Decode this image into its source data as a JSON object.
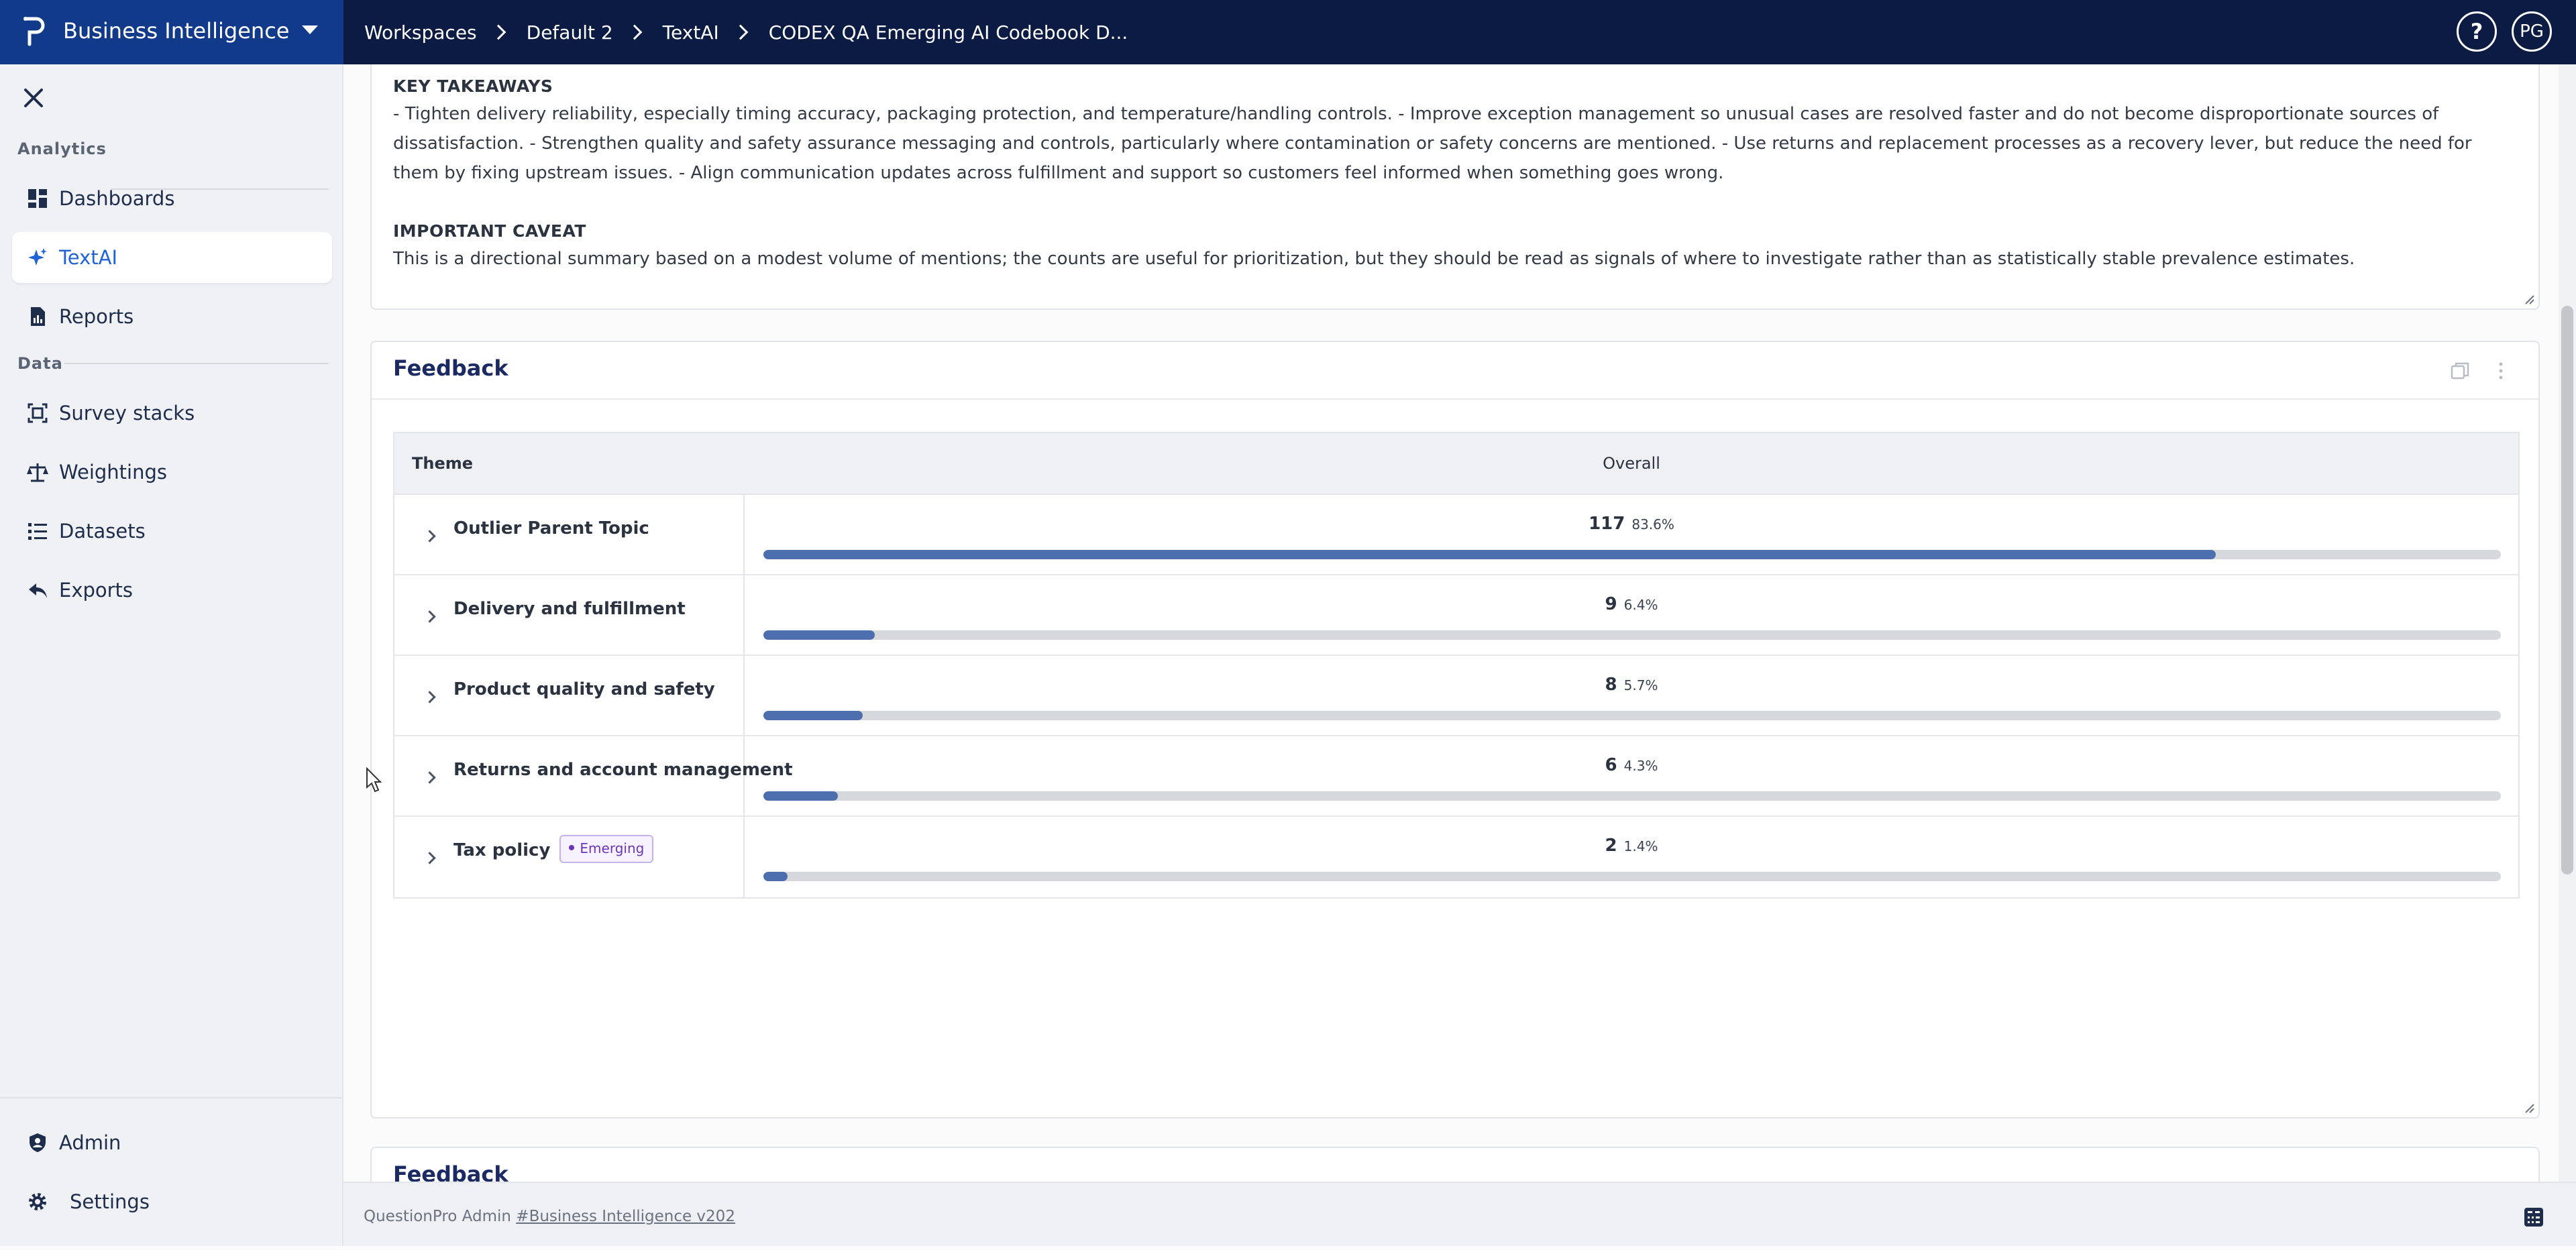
{
  "app": {
    "title": "Business Intelligence",
    "breadcrumbs": [
      "Workspaces",
      "Default 2",
      "TextAI",
      "CODEX QA Emerging AI Codebook D..."
    ],
    "avatar_initials": "PG",
    "help_label": "?"
  },
  "sidebar": {
    "analytics_heading": "Analytics",
    "data_heading": "Data",
    "items": [
      {
        "label": "Dashboards",
        "icon": "dashboard-icon"
      },
      {
        "label": "TextAI",
        "icon": "sparkle-icon",
        "active": true
      },
      {
        "label": "Reports",
        "icon": "report-icon"
      },
      {
        "label": "Survey stacks",
        "icon": "survey-stack-icon"
      },
      {
        "label": "Weightings",
        "icon": "scale-icon"
      },
      {
        "label": "Datasets",
        "icon": "list-icon"
      },
      {
        "label": "Exports",
        "icon": "export-icon"
      }
    ],
    "bottom_items": [
      {
        "label": "Admin",
        "icon": "admin-shield-icon"
      },
      {
        "label": "Settings",
        "icon": "gear-icon"
      }
    ]
  },
  "summary": {
    "takeaways_heading": "KEY TAKEAWAYS",
    "takeaways_text": "- Tighten delivery reliability, especially timing accuracy, packaging protection, and temperature/handling controls. - Improve exception management so unusual cases are resolved faster and do not become disproportionate sources of dissatisfaction. - Strengthen quality and safety assurance messaging and controls, particularly where contamination or safety concerns are mentioned. - Use returns and replacement processes as a recovery lever, but reduce the need for them by fixing upstream issues. - Align communication updates across fulfillment and support so customers feel informed when something goes wrong.",
    "caveat_heading": "IMPORTANT CAVEAT",
    "caveat_text": "This is a directional summary based on a modest volume of mentions; the counts are useful for prioritization, but they should be read as signals of where to investigate rather than as statistically stable prevalence estimates."
  },
  "feedback_panel": {
    "title": "Feedback",
    "col_theme": "Theme",
    "col_overall": "Overall",
    "rows": [
      {
        "label": "Outlier Parent Topic",
        "count": "117",
        "pct": "83.6%",
        "fraction": 0.836,
        "badge": ""
      },
      {
        "label": "Delivery and fulfillment",
        "count": "9",
        "pct": "6.4%",
        "fraction": 0.064,
        "badge": ""
      },
      {
        "label": "Product quality and safety",
        "count": "8",
        "pct": "5.7%",
        "fraction": 0.057,
        "badge": ""
      },
      {
        "label": "Returns and account management",
        "count": "6",
        "pct": "4.3%",
        "fraction": 0.043,
        "badge": ""
      },
      {
        "label": "Tax policy",
        "count": "2",
        "pct": "1.4%",
        "fraction": 0.014,
        "badge": "Emerging"
      }
    ]
  },
  "feedback_panel_2": {
    "title": "Feedback"
  },
  "footer": {
    "prefix": "QuestionPro Admin",
    "link": "#Business Intelligence v202"
  },
  "colors": {
    "topbar": "#0b1b43",
    "brand": "#113a8a",
    "bar_fill": "#4e6fae",
    "bar_track": "#d6d8dc",
    "active": "#1f63d6",
    "emerging_badge": "#6b36b8"
  }
}
